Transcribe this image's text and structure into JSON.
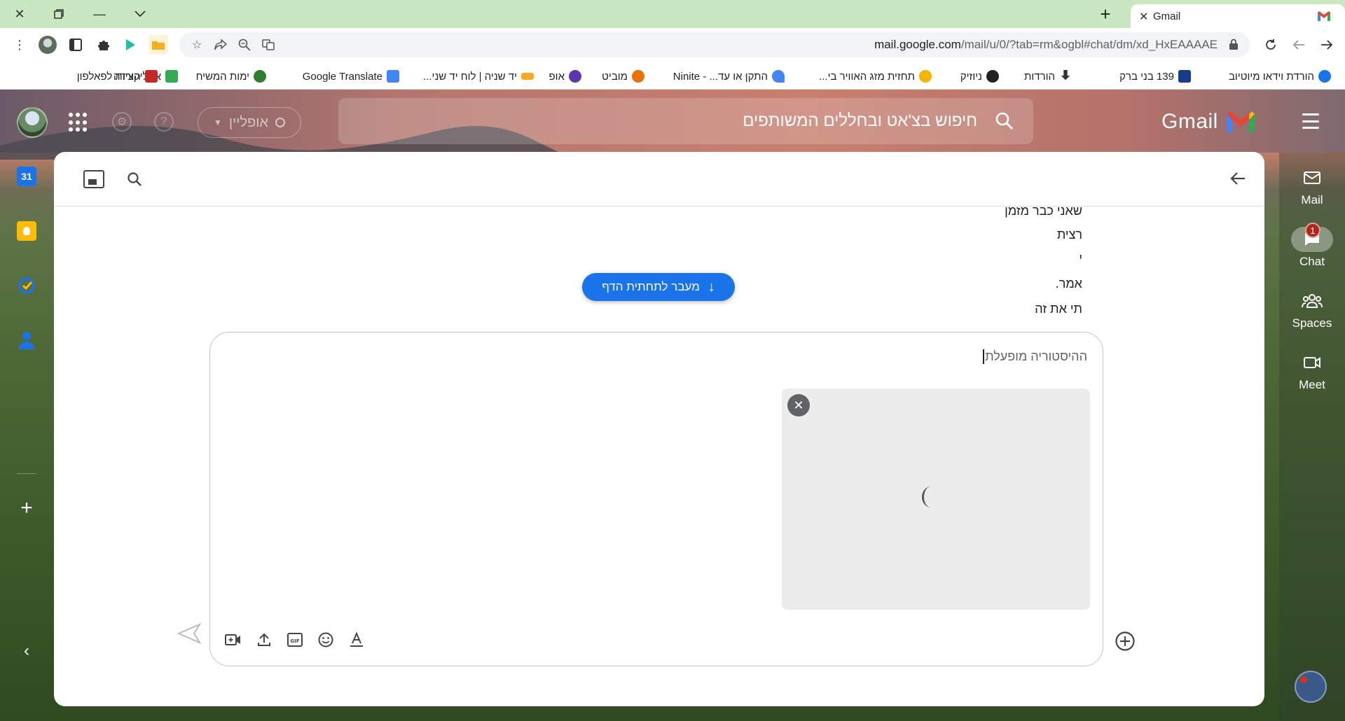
{
  "browser": {
    "tab": {
      "title": "Gmail"
    },
    "url": {
      "prefix": "mail.google.com",
      "rest": "/mail/u/0/?tab=rm&ogbl#chat/dm/xd_HxEAAAAE"
    },
    "bookmarks": [
      {
        "label": "הורדת וידאו מיוטיוב",
        "color": "#1a73e8"
      },
      {
        "label": "139 בני ברק",
        "color": "#1a3a8a"
      },
      {
        "label": "הורדות",
        "color": "#333333"
      },
      {
        "label": "ניוזיק",
        "color": "#222222"
      },
      {
        "label": "תחזית מזג האוויר בי...",
        "color": "#f4b400"
      },
      {
        "label": "התקן או עד... - Ninite",
        "color": "#4285f4"
      },
      {
        "label": "מוביט",
        "color": "#e8710a"
      },
      {
        "label": "אופ",
        "color": "#5e35b1"
      },
      {
        "label": "יד שניה | לוח יד שני...",
        "color": "#f9a825"
      },
      {
        "label": "Google Translate",
        "color": "#4285f4"
      },
      {
        "label": "ימות המשיח",
        "color": "#2e7d32"
      },
      {
        "label": "אפליקציות לפאלפון",
        "color": "#34a853"
      },
      {
        "label": "הורדה",
        "color": "#c62828"
      }
    ]
  },
  "gmail": {
    "logo_text": "Gmail",
    "search_placeholder": "חיפוש בצ'אט ובחללים המשותפים",
    "status_label": "אופליין",
    "nav": [
      {
        "label": "Mail",
        "icon": "mail-icon"
      },
      {
        "label": "Chat",
        "icon": "chat-icon",
        "badge": "1"
      },
      {
        "label": "Spaces",
        "icon": "spaces-icon"
      },
      {
        "label": "Meet",
        "icon": "meet-icon"
      }
    ],
    "side_apps": [
      "calendar-icon",
      "keep-icon",
      "tasks-icon",
      "contacts-icon"
    ],
    "calendar_day": "31"
  },
  "chat": {
    "messages": [
      "שאני כבר מזמן",
      "רצית",
      "י",
      "אמר.",
      "תי את זה"
    ],
    "jump_button": "מעבר לתחתית הדף",
    "compose_text": "ההיסטוריה מופעלת"
  }
}
